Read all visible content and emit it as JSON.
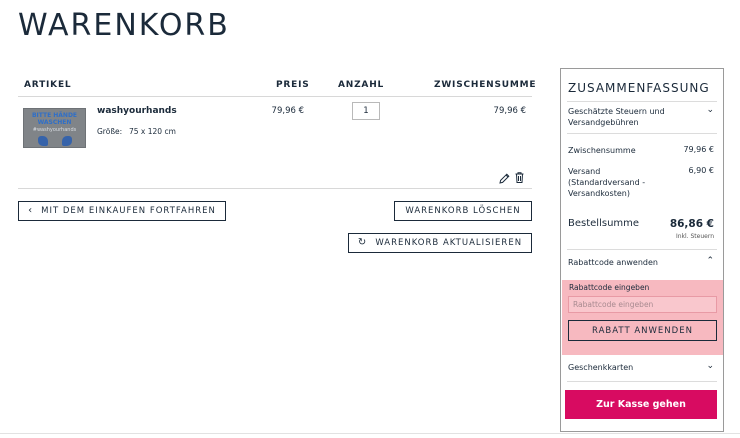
{
  "page": {
    "title": "WARENKORB"
  },
  "cart": {
    "headers": {
      "article": "ARTIKEL",
      "price": "PREIS",
      "quantity": "ANZAHL",
      "subtotal": "ZWISCHENSUMME"
    },
    "items": [
      {
        "name": "washyourhands",
        "image_text_line1": "BITTE HÄNDE",
        "image_text_line2": "WASCHEN",
        "image_text_line3": "#washyourhands",
        "attr_label": "Größe:",
        "attr_value": "75 x 120 cm",
        "price": "79,96 €",
        "quantity": "1",
        "subtotal": "79,96 €"
      }
    ],
    "actions": {
      "continue_label": "MIT DEM EINKAUFEN FORTFAHREN",
      "continue_icon": "chevron-left-icon",
      "clear_label": "WARENKORB LÖSCHEN",
      "update_label": "WARENKORB AKTUALISIEREN",
      "update_icon": "refresh-icon",
      "edit_icon": "pencil-icon",
      "delete_icon": "trash-icon"
    }
  },
  "summary": {
    "title": "ZUSAMMENFASSUNG",
    "taxes_label_line1": "Geschätzte Steuern und",
    "taxes_label_line2": "Versandgebühren",
    "subtotal_label": "Zwischensumme",
    "subtotal_value": "79,96 €",
    "shipping_label_line1": "Versand",
    "shipping_label_line2": "(Standardversand -",
    "shipping_label_line3": "Versandkosten)",
    "shipping_value": "6,90 €",
    "total_label": "Bestellsumme",
    "total_value": "86,86 €",
    "total_note": "Inkl. Steuern",
    "discount_section_label": "Rabattcode anwenden",
    "discount_field_label": "Rabattcode eingeben",
    "discount_placeholder": "Rabattcode eingeben",
    "discount_button": "RABATT ANWENDEN",
    "giftcards_label": "Geschenkkarten",
    "checkout_button": "Zur Kasse gehen"
  },
  "colors": {
    "text": "#1b2a3a",
    "accent": "#d80b61",
    "discount_highlight": "#f7b9c0"
  }
}
